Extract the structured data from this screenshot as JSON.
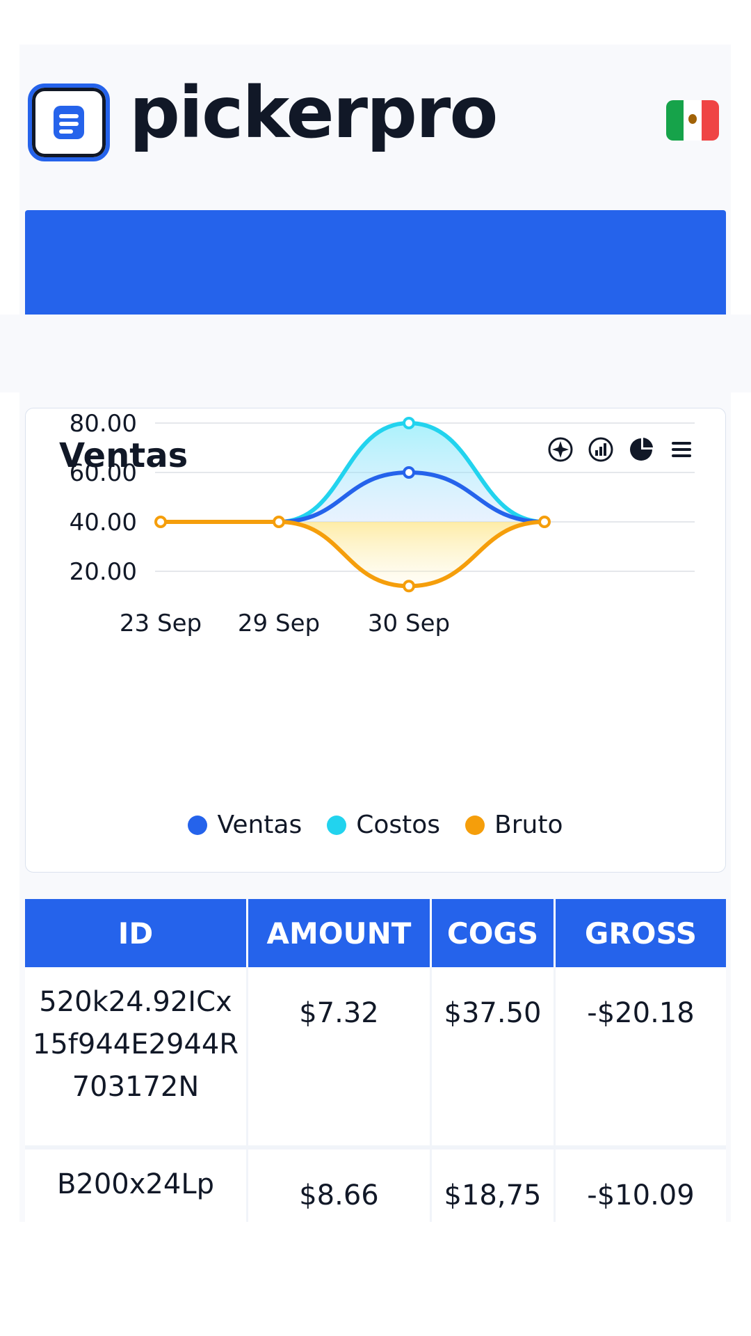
{
  "app": {
    "brand": "pickerpro",
    "flag": "Mexico flag"
  },
  "chart_card": {
    "title": "Ventas",
    "tools": [
      "compass-icon",
      "bar-chart-icon",
      "pie-chart-icon",
      "menu-icon"
    ]
  },
  "chart_data": {
    "type": "area",
    "categories": [
      "23 Sep",
      "29 Sep",
      "30 Sep",
      ""
    ],
    "ylim": [
      20,
      80
    ],
    "yticks": [
      "80.00",
      "60.00",
      "40.00",
      "20.00"
    ],
    "grid": true,
    "legend_position": "bottom",
    "series": [
      {
        "name": "Ventas",
        "color": "#2563eb",
        "values": [
          40,
          40,
          60,
          40
        ]
      },
      {
        "name": "Costos",
        "color": "#22d3ee",
        "values": [
          40,
          40,
          80,
          40
        ]
      },
      {
        "name": "Bruto",
        "color": "#f59e0b",
        "values": [
          40,
          40,
          14,
          40
        ]
      }
    ]
  },
  "table": {
    "headers": [
      "ID",
      "AMOUNT",
      "COGS",
      "GROSS"
    ],
    "rows": [
      {
        "id": "520k24.92ICx15f944E2944R703172N",
        "amount": "$7.32",
        "cogs": "$37.50",
        "gross": "-$20.18"
      },
      {
        "id": "B200x24Lp",
        "amount": "$8.66",
        "cogs": "$18,75",
        "gross": "-$10.09"
      }
    ]
  }
}
